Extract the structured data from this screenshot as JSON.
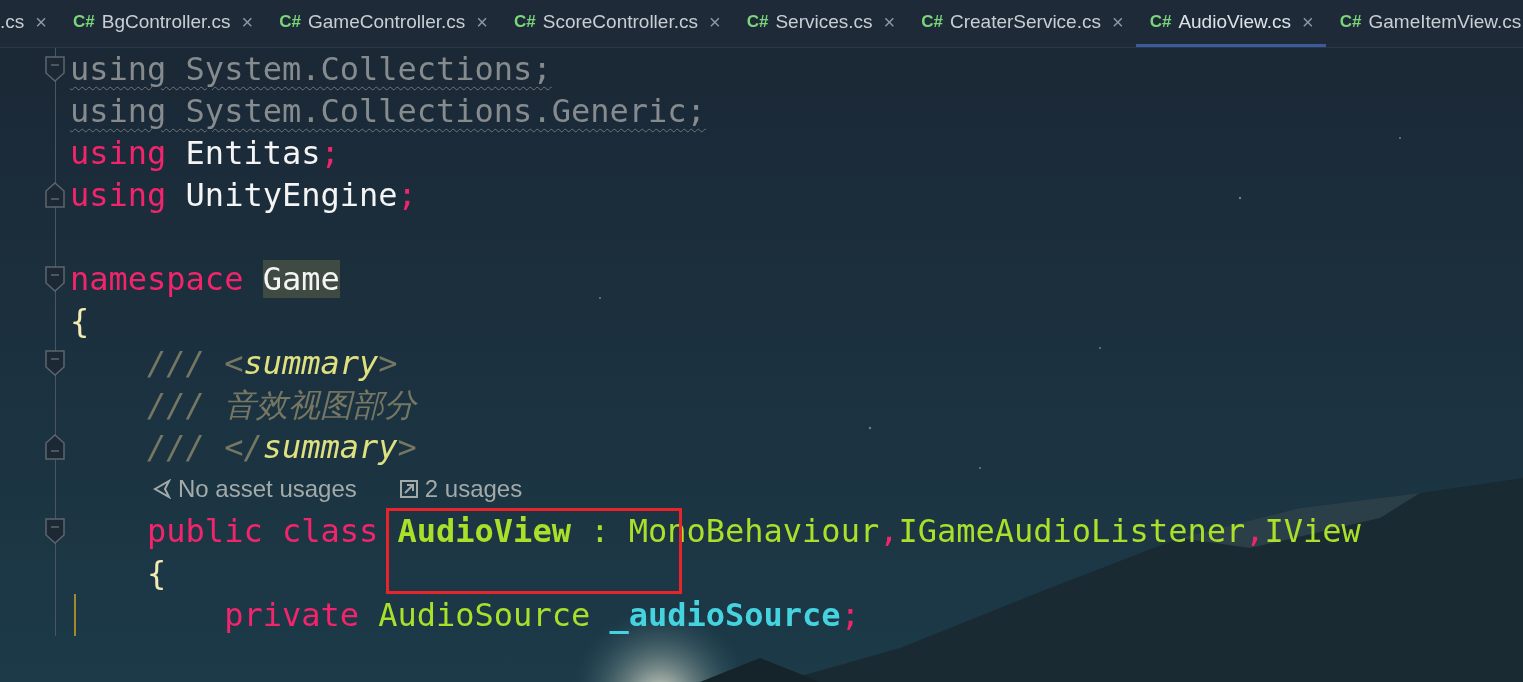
{
  "tabs": [
    {
      "label": ".cs",
      "close": "×",
      "selected": false
    },
    {
      "label": "BgController.cs",
      "icon": "C#",
      "close": "×",
      "selected": false
    },
    {
      "label": "GameController.cs",
      "icon": "C#",
      "close": "×",
      "selected": false
    },
    {
      "label": "ScoreController.cs",
      "icon": "C#",
      "close": "×",
      "selected": false
    },
    {
      "label": "Services.cs",
      "icon": "C#",
      "close": "×",
      "selected": false
    },
    {
      "label": "CreaterService.cs",
      "icon": "C#",
      "close": "×",
      "selected": false
    },
    {
      "label": "AudioView.cs",
      "icon": "C#",
      "close": "×",
      "selected": true
    },
    {
      "label": "GameItemView.cs",
      "icon": "C#",
      "selected": false
    }
  ],
  "editor": {
    "lines": [
      {
        "kind": "code",
        "fold_start": true,
        "fold_end": false,
        "guide": false,
        "tokens": [
          {
            "t": "using System.Collections;",
            "kind": "unused"
          }
        ]
      },
      {
        "kind": "code",
        "fold_start": false,
        "fold_end": false,
        "guide": false,
        "tokens": [
          {
            "t": "using System.Collections.Generic;",
            "kind": "unused"
          }
        ]
      },
      {
        "kind": "code",
        "fold_start": false,
        "fold_end": false,
        "guide": false,
        "tokens": [
          {
            "t": "using",
            "kind": "keyword"
          },
          {
            "t": " Entitas",
            "kind": "plain"
          },
          {
            "t": ";",
            "kind": "punct"
          }
        ]
      },
      {
        "kind": "code",
        "fold_start": false,
        "fold_end": true,
        "guide": false,
        "tokens": [
          {
            "t": "using",
            "kind": "keyword"
          },
          {
            "t": " UnityEngine",
            "kind": "plain"
          },
          {
            "t": ";",
            "kind": "punct"
          }
        ]
      },
      {
        "kind": "blank",
        "fold_start": false,
        "fold_end": false,
        "guide": false
      },
      {
        "kind": "code",
        "fold_start": true,
        "fold_end": false,
        "guide": false,
        "tokens": [
          {
            "t": "namespace ",
            "kind": "keyword"
          },
          {
            "t": "Game",
            "kind": "match"
          }
        ]
      },
      {
        "kind": "code",
        "fold_start": false,
        "fold_end": false,
        "guide": false,
        "tokens": [
          {
            "t": "{",
            "kind": "brace"
          }
        ]
      },
      {
        "kind": "code",
        "fold_start": true,
        "fold_end": false,
        "guide": false,
        "tokens": [
          {
            "t": "    /// <",
            "kind": "comment"
          },
          {
            "t": "summary",
            "kind": "doctag"
          },
          {
            "t": ">",
            "kind": "comment"
          }
        ]
      },
      {
        "kind": "code",
        "fold_start": false,
        "fold_end": false,
        "guide": false,
        "tokens": [
          {
            "t": "    /// 音效视图部分",
            "kind": "comment"
          }
        ]
      },
      {
        "kind": "code",
        "fold_start": false,
        "fold_end": true,
        "guide": false,
        "tokens": [
          {
            "t": "    /// </",
            "kind": "comment"
          },
          {
            "t": "summary",
            "kind": "doctag"
          },
          {
            "t": ">",
            "kind": "comment"
          }
        ]
      },
      {
        "kind": "codelens",
        "fold_start": false,
        "fold_end": false,
        "guide": false,
        "items": [
          {
            "label": "No asset usages"
          },
          {
            "label": "2 usages"
          }
        ]
      },
      {
        "kind": "code",
        "fold_start": true,
        "fold_end": false,
        "guide": false,
        "tokens": [
          {
            "t": "    public class ",
            "kind": "keyword"
          },
          {
            "t": "AudioView",
            "kind": "decl"
          },
          {
            "t": " : MonoBehaviour",
            "kind": "type"
          },
          {
            "t": ",",
            "kind": "punct"
          },
          {
            "t": "IGameAudioListener",
            "kind": "type"
          },
          {
            "t": ",",
            "kind": "punct"
          },
          {
            "t": "IView",
            "kind": "type"
          }
        ]
      },
      {
        "kind": "code",
        "fold_start": false,
        "fold_end": false,
        "guide": false,
        "tokens": [
          {
            "t": "    {",
            "kind": "brace"
          }
        ]
      },
      {
        "kind": "code",
        "fold_start": false,
        "fold_end": false,
        "guide": true,
        "tokens": [
          {
            "t": "        private ",
            "kind": "keyword"
          },
          {
            "t": "AudioSource ",
            "kind": "type"
          },
          {
            "t": "_audioSource",
            "kind": "field"
          },
          {
            "t": ";",
            "kind": "punct"
          }
        ]
      }
    ]
  },
  "annotations": [
    {
      "kind": "box",
      "color": "#e8232a"
    }
  ]
}
